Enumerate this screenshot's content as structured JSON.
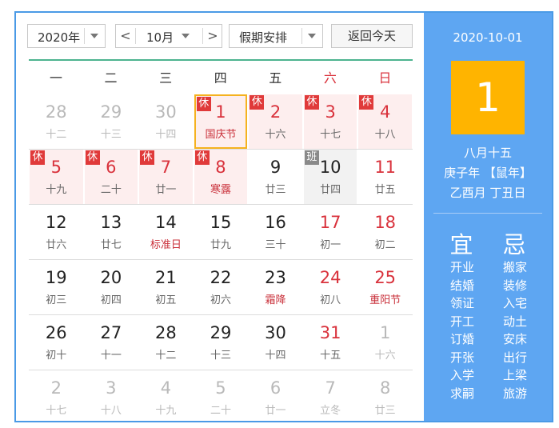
{
  "toolbar": {
    "year": "2020年",
    "prev": "<",
    "month": "10月",
    "next": ">",
    "holiday": "假期安排",
    "today": "返回今天"
  },
  "weekdays": [
    "一",
    "二",
    "三",
    "四",
    "五",
    "六",
    "日"
  ],
  "rows": [
    [
      {
        "d": "28",
        "l": "十二",
        "t": "grey"
      },
      {
        "d": "29",
        "l": "十三",
        "t": "grey"
      },
      {
        "d": "30",
        "l": "十四",
        "t": "grey"
      },
      {
        "d": "1",
        "l": "国庆节",
        "t": "red",
        "lt": "red",
        "bg": "hol",
        "badge": "休",
        "sel": true
      },
      {
        "d": "2",
        "l": "十六",
        "t": "red",
        "bg": "hol",
        "badge": "休"
      },
      {
        "d": "3",
        "l": "十七",
        "t": "red",
        "bg": "hol",
        "badge": "休"
      },
      {
        "d": "4",
        "l": "十八",
        "t": "red",
        "bg": "hol",
        "badge": "休"
      }
    ],
    [
      {
        "d": "5",
        "l": "十九",
        "t": "red",
        "bg": "hol",
        "badge": "休"
      },
      {
        "d": "6",
        "l": "二十",
        "t": "red",
        "bg": "hol",
        "badge": "休"
      },
      {
        "d": "7",
        "l": "廿一",
        "t": "red",
        "bg": "hol",
        "badge": "休"
      },
      {
        "d": "8",
        "l": "寒露",
        "t": "red",
        "lt": "red",
        "bg": "hol",
        "badge": "休"
      },
      {
        "d": "9",
        "l": "廿三",
        "t": "normal"
      },
      {
        "d": "10",
        "l": "廿四",
        "t": "normal",
        "bg": "work",
        "badge": "班",
        "btype": "ban"
      },
      {
        "d": "11",
        "l": "廿五",
        "t": "red"
      }
    ],
    [
      {
        "d": "12",
        "l": "廿六",
        "t": "normal"
      },
      {
        "d": "13",
        "l": "廿七",
        "t": "normal"
      },
      {
        "d": "14",
        "l": "标准日",
        "t": "normal",
        "lt": "red"
      },
      {
        "d": "15",
        "l": "廿九",
        "t": "normal"
      },
      {
        "d": "16",
        "l": "三十",
        "t": "normal"
      },
      {
        "d": "17",
        "l": "初一",
        "t": "red"
      },
      {
        "d": "18",
        "l": "初二",
        "t": "red"
      }
    ],
    [
      {
        "d": "19",
        "l": "初三",
        "t": "normal"
      },
      {
        "d": "20",
        "l": "初四",
        "t": "normal"
      },
      {
        "d": "21",
        "l": "初五",
        "t": "normal"
      },
      {
        "d": "22",
        "l": "初六",
        "t": "normal"
      },
      {
        "d": "23",
        "l": "霜降",
        "t": "normal",
        "lt": "red"
      },
      {
        "d": "24",
        "l": "初八",
        "t": "red"
      },
      {
        "d": "25",
        "l": "重阳节",
        "t": "red",
        "lt": "red"
      }
    ],
    [
      {
        "d": "26",
        "l": "初十",
        "t": "normal"
      },
      {
        "d": "27",
        "l": "十一",
        "t": "normal"
      },
      {
        "d": "28",
        "l": "十二",
        "t": "normal"
      },
      {
        "d": "29",
        "l": "十三",
        "t": "normal"
      },
      {
        "d": "30",
        "l": "十四",
        "t": "normal"
      },
      {
        "d": "31",
        "l": "十五",
        "t": "red"
      },
      {
        "d": "1",
        "l": "十六",
        "t": "grey"
      }
    ],
    [
      {
        "d": "2",
        "l": "十七",
        "t": "grey"
      },
      {
        "d": "3",
        "l": "十八",
        "t": "grey"
      },
      {
        "d": "4",
        "l": "十九",
        "t": "grey"
      },
      {
        "d": "5",
        "l": "二十",
        "t": "grey"
      },
      {
        "d": "6",
        "l": "廿一",
        "t": "grey"
      },
      {
        "d": "7",
        "l": "立冬",
        "t": "grey"
      },
      {
        "d": "8",
        "l": "廿三",
        "t": "grey"
      }
    ]
  ],
  "panel": {
    "date": "2020-10-01",
    "day": "1",
    "lunar": "八月十五",
    "year_info": "庚子年 【鼠年】",
    "ganzhi": "乙酉月 丁丑日",
    "yi": "宜",
    "ji": "忌",
    "yi_list": [
      "开业",
      "结婚",
      "领证",
      "开工",
      "订婚",
      "开张",
      "入学",
      "求嗣"
    ],
    "ji_list": [
      "搬家",
      "装修",
      "入宅",
      "动土",
      "安床",
      "出行",
      "上梁",
      "旅游"
    ]
  },
  "colors": {
    "border": "#4a9ae6",
    "panel_bg": "#5ea6f2",
    "day_box": "#ffb400",
    "holiday_red": "#d9323c",
    "selected": "#f5b21f"
  }
}
